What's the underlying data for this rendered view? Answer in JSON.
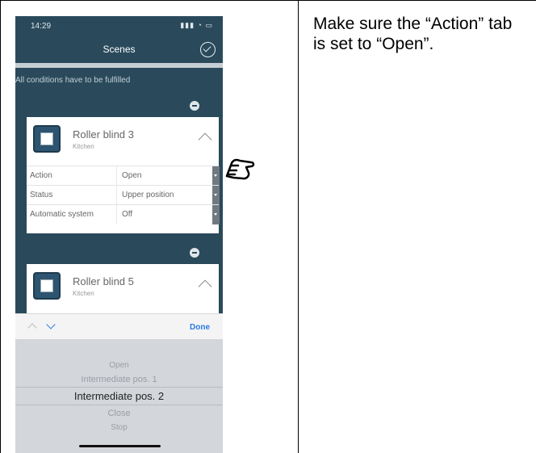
{
  "status_bar": {
    "time": "14:29",
    "icons": "signal-wifi-battery"
  },
  "nav": {
    "title": "Scenes",
    "confirm_icon": "check-circle-icon"
  },
  "conditions_note": "All conditions have to be fulfilled",
  "cards": [
    {
      "name": "Roller blind 3",
      "room": "Kitchen",
      "rows": [
        {
          "label": "Action",
          "value": "Open"
        },
        {
          "label": "Status",
          "value": "Upper position"
        },
        {
          "label": "Automatic system",
          "value": "Off"
        }
      ]
    },
    {
      "name": "Roller blind 5",
      "room": "Kitchen"
    }
  ],
  "accessory": {
    "done_label": "Done"
  },
  "picker": {
    "options": [
      "Open",
      "Intermediate pos. 1",
      "Intermediate pos. 2",
      "Close",
      "Stop"
    ],
    "selected": "Intermediate pos. 2"
  },
  "instruction": "Make sure the “Action” tab is set to “Open”.",
  "colors": {
    "app_bg": "#2a4a5c",
    "accent": "#2c7be5",
    "picker_bg": "#d3d6da"
  }
}
